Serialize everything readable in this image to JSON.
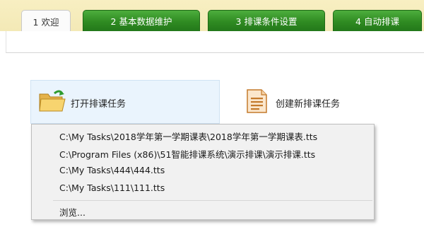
{
  "tabs": [
    {
      "label": "1 欢迎",
      "active": true
    },
    {
      "label": "2 基本数据维护",
      "active": false
    },
    {
      "label": "3 排课条件设置",
      "active": false
    },
    {
      "label": "4 自动排课",
      "active": false
    }
  ],
  "tasks": {
    "open_label": "打开排课任务",
    "new_label": "创建新排课任务"
  },
  "recent_menu": {
    "items": [
      "C:\\My Tasks\\2018学年第一学期课表\\2018学年第一学期课表.tts",
      "C:\\Program Files (x86)\\51智能排课系统\\演示排课\\演示排课.tts",
      "C:\\My Tasks\\444\\444.tts",
      "C:\\My Tasks\\111\\111.tts"
    ],
    "browse_label": "浏览..."
  },
  "colors": {
    "tab_green": "#2f8b22",
    "tabbar_bg": "#f3e9b6",
    "open_task_bg": "#eaf4fd"
  },
  "icons": {
    "open": "folder-open-icon",
    "new": "new-document-icon"
  }
}
